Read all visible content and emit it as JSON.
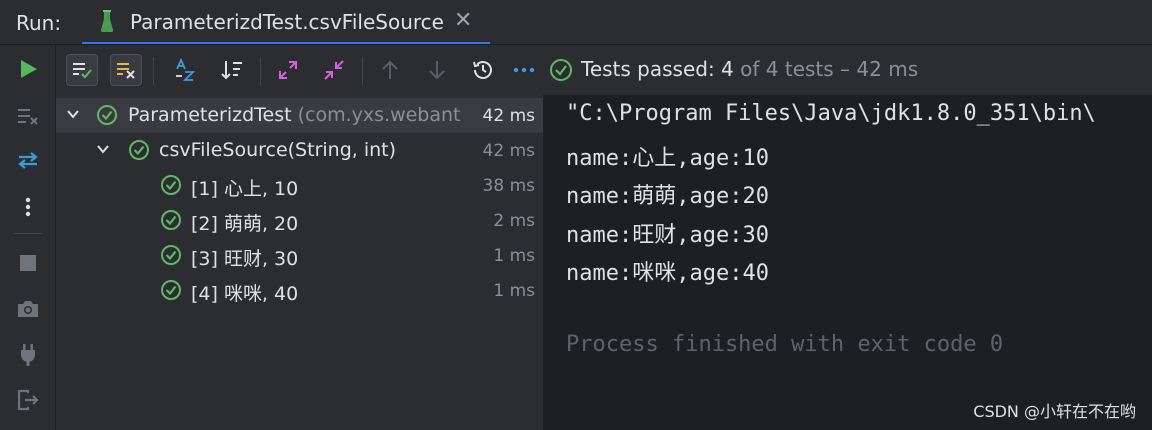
{
  "run_tab": {
    "label": "Run:",
    "tab_title": "ParameterizdTest.csvFileSource",
    "close_glyph": "✕"
  },
  "toolbar": {
    "status_lead": "Tests passed: 4",
    "status_rest": " of 4 tests – 42 ms"
  },
  "tree": {
    "root": {
      "name": "ParameterizdTest",
      "package": " (com.yxs.webant",
      "time": "42 ms"
    },
    "method": {
      "name": "csvFileSource(String, int)",
      "time": "42 ms"
    },
    "cases": [
      {
        "label": "[1] 心上, 10",
        "time": "38 ms"
      },
      {
        "label": "[2] 萌萌, 20",
        "time": "2 ms"
      },
      {
        "label": "[3] 旺财, 30",
        "time": "1 ms"
      },
      {
        "label": "[4] 咪咪, 40",
        "time": "1 ms"
      }
    ]
  },
  "console": {
    "command": "\"C:\\Program Files\\Java\\jdk1.8.0_351\\bin\\",
    "lines": [
      "name:心上,age:10",
      "name:萌萌,age:20",
      "name:旺财,age:30",
      "name:咪咪,age:40"
    ],
    "exit": "Process finished with exit code 0"
  },
  "watermark": "CSDN @小轩在不在哟",
  "colors": {
    "pass_green": "#5fb865",
    "accent_blue": "#3574f0",
    "warning_yellow": "#e6b450",
    "run_green": "#57b65f"
  },
  "icons": [
    "run-icon",
    "soft-wrap-icon",
    "rerun-icon",
    "more-vertical-icon",
    "stop-icon",
    "camera-icon",
    "plug-icon",
    "exit-icon",
    "show-passed-icon",
    "show-ignored-icon",
    "sort-alpha-icon",
    "sort-duration-icon",
    "expand-all-icon",
    "collapse-all-icon",
    "prev-failed-icon",
    "next-failed-icon",
    "history-icon",
    "more-horizontal-icon",
    "test-passed-icon",
    "chevron-down-icon"
  ]
}
